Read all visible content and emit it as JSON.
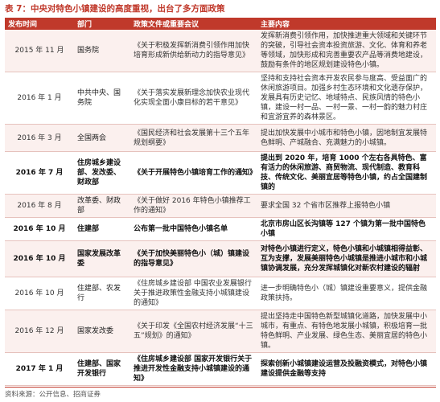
{
  "caption": "表 7：中央对特色小镇建设的高度重视，出台了多方面政策",
  "columns": [
    "发布时间",
    "部门",
    "政策文件或重要会议",
    "主要内容"
  ],
  "rows": [
    {
      "time": "2015 年 11 月",
      "dept": "国务院",
      "doc": "《关于积极发挥新消费引领作用加快培育形成新供给新动力的指导意见》",
      "main": "发挥新消费引领作用，加快推进重大领域和关键环节的突破，引导社会资本投资旅游、文化、体育和养老等领域，加快形成和完善重要农产品等消费地建设，鼓励有条件的地区规划建设特色小镇。",
      "bold": false
    },
    {
      "time": "2016 年 1 月",
      "dept": "中共中央、国务院",
      "doc": "《关于落实发展新理念加快农业现代化实现全面小康目标的若干意见》",
      "main": "坚持和支持社会资本开发农民参与度高、受益面广的休闲旅游项目。加强乡村生态环境和文化遗存保护，发展具有历史记忆、地域特点、民族风情的特色小镇，建设一村一品、一村一景、一村一韵的魅力村庄和宜游宜养的森林景区。",
      "bold": false
    },
    {
      "time": "2016 年 3 月",
      "dept": "全国两会",
      "doc": "《国民经济和社会发展第十三个五年规划纲要》",
      "main": "提出加快发展中小城市和特色小镇，因地制宜发展特色鲜明、产城融合、充满魅力的小城镇。",
      "bold": false
    },
    {
      "time": "2016 年 7 月",
      "dept": "住房城乡建设部、发改委、财政部",
      "doc": "《关于开展特色小镇培育工作的通知》",
      "main": "提出到 2020 年，培育 1000 个左右各具特色、富有活力的休闲旅游、商贸物流、现代制造、教育科技、传统文化、美丽宜居等特色小镇，约占全国建制镇的",
      "bold": true
    },
    {
      "time": "2016 年 8 月",
      "dept": "改革委、财政部",
      "doc": "《关于做好 2016 年特色小镇推荐工作的通知》",
      "main": "要求全国 32 个省市区推荐上报特色小镇",
      "bold": false
    },
    {
      "time": "2016 年 10 月",
      "dept": "住建部",
      "doc": "公布第一批中国特色小镇名单",
      "main": "北京市房山区长沟镇等 127 个镇为第一批中国特色小镇",
      "bold": true
    },
    {
      "time": "2016 年 10 月",
      "dept": "国家发展改革委",
      "doc": "《关于加快美丽特色小（城）镇建设的指导意见》",
      "main": "对特色小镇进行定义，特色小镇和小城镇相得益彰、互为支撑，发展美丽特色小城镇是推进小城市和小城镇协调发展，充分发挥城镇化对新农村建设的辐射",
      "bold": true
    },
    {
      "time": "2016 年 10 月",
      "dept": "住建部、农发行",
      "doc": "《住房城乡建设部 中国农业发展银行关于推进政策性金融支持小城镇建设的通知》",
      "main": "进一步明确特色小（城）镇建设重要意义，提供金融政策扶持。",
      "bold": false
    },
    {
      "time": "2016 年 12 月",
      "dept": "国家发改委",
      "doc": "《关于印发《全国农村经济发展“十三五”规划》的通知》",
      "main": "提出坚持走中国特色新型城镇化道路，加快发展中小城市，有重点、有特色地发展小城镇，积极培育一批特色鲜明、产业发展、绿色生态、美丽宜居的特色小镇。",
      "bold": false
    },
    {
      "time": "2017 年 1 月",
      "dept": "住建部、国家开发银行",
      "doc": "《住房城乡建设部 国家开发银行关于推进开发性金融支持小城镇建设的通知》",
      "main": "探索创新小城镇建设运营及投融资模式，对特色小镇建设提供金融等支持",
      "bold": true
    }
  ],
  "source": "资料来源：公开信息、招商证券"
}
